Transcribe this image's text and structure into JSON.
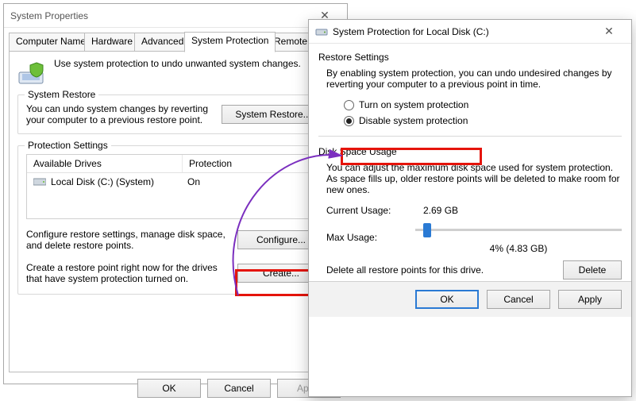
{
  "w1": {
    "title": "System Properties",
    "tabs": [
      "Computer Name",
      "Hardware",
      "Advanced",
      "System Protection",
      "Remote"
    ],
    "active_tab": 3,
    "desc": "Use system protection to undo unwanted system changes.",
    "restore": {
      "legend": "System Restore",
      "text": "You can undo system changes by reverting your computer to a previous restore point.",
      "btn": "System Restore..."
    },
    "protection": {
      "legend": "Protection Settings",
      "cols": [
        "Available Drives",
        "Protection"
      ],
      "rows": [
        {
          "drive": "Local Disk (C:) (System)",
          "status": "On"
        }
      ],
      "configure_text": "Configure restore settings, manage disk space, and delete restore points.",
      "configure_btn": "Configure...",
      "create_text": "Create a restore point right now for the drives that have system protection turned on.",
      "create_btn": "Create..."
    },
    "ok": "OK",
    "cancel": "Cancel",
    "apply": "Apply"
  },
  "w2": {
    "title": "System Protection for Local Disk (C:)",
    "restore_head": "Restore Settings",
    "restore_desc": "By enabling system protection, you can undo undesired changes by reverting your computer to a previous point in time.",
    "radios": {
      "on": "Turn on system protection",
      "off": "Disable system protection",
      "selected": "off"
    },
    "disk_head": "Disk Space Usage",
    "disk_desc": "You can adjust the maximum disk space used for system protection. As space fills up, older restore points will be deleted to make room for new ones.",
    "current_label": "Current Usage:",
    "current_value": "2.69 GB",
    "max_label": "Max Usage:",
    "slider_percent": 4,
    "slider_caption": "4% (4.83 GB)",
    "delete_text": "Delete all restore points for this drive.",
    "delete_btn": "Delete",
    "ok": "OK",
    "cancel": "Cancel",
    "apply": "Apply"
  }
}
